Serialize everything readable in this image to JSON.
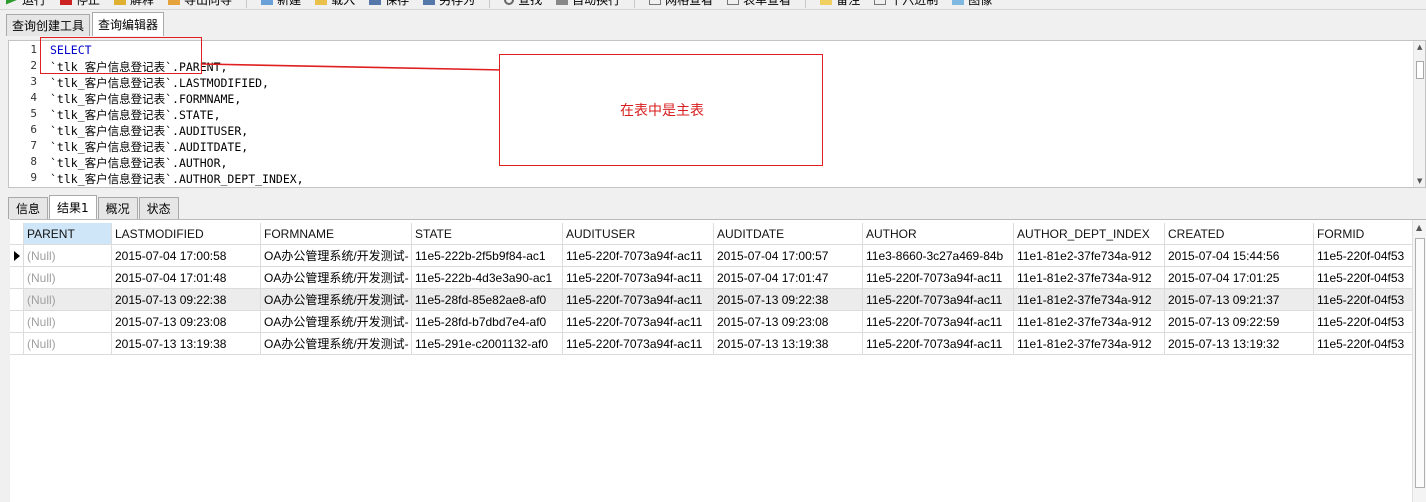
{
  "toolbar": {
    "items": [
      "运行",
      "停止",
      "解释",
      "导出向导",
      "新建",
      "载入",
      "保存",
      "另存为",
      "查找",
      "自动换行",
      "网格查看",
      "表单查看",
      "备注",
      "十六进制",
      "图像"
    ]
  },
  "editor_tabs": [
    "查询创建工具",
    "查询编辑器"
  ],
  "editor": {
    "lines": [
      {
        "n": "1",
        "text": "SELECT"
      },
      {
        "n": "2",
        "text": "`tlk_客户信息登记表`.PARENT,"
      },
      {
        "n": "3",
        "text": "`tlk_客户信息登记表`.LASTMODIFIED,"
      },
      {
        "n": "4",
        "text": "`tlk_客户信息登记表`.FORMNAME,"
      },
      {
        "n": "5",
        "text": "`tlk_客户信息登记表`.STATE,"
      },
      {
        "n": "6",
        "text": "`tlk_客户信息登记表`.AUDITUSER,"
      },
      {
        "n": "7",
        "text": "`tlk_客户信息登记表`.AUDITDATE,"
      },
      {
        "n": "8",
        "text": "`tlk_客户信息登记表`.AUTHOR,"
      },
      {
        "n": "9",
        "text": "`tlk_客户信息登记表`.AUTHOR_DEPT_INDEX,"
      }
    ]
  },
  "annotation": {
    "text": "在表中是主表",
    "color": "#d81e1e"
  },
  "result_tabs": [
    "信息",
    "结果1",
    "概况",
    "状态"
  ],
  "grid": {
    "columns": [
      "PARENT",
      "LASTMODIFIED",
      "FORMNAME",
      "STATE",
      "AUDITUSER",
      "AUDITDATE",
      "AUTHOR",
      "AUTHOR_DEPT_INDEX",
      "CREATED",
      "FORMID"
    ],
    "rows": [
      [
        "(Null)",
        "2015-07-04 17:00:58",
        "OA办公管理系统/开发测试-",
        "11e5-222b-2f5b9f84-ac1",
        "11e5-220f-7073a94f-ac11",
        "2015-07-04 17:00:57",
        "11e3-8660-3c27a469-84b",
        "11e1-81e2-37fe734a-912",
        "2015-07-04 15:44:56",
        "11e5-220f-04f53"
      ],
      [
        "(Null)",
        "2015-07-04 17:01:48",
        "OA办公管理系统/开发测试-",
        "11e5-222b-4d3e3a90-ac1",
        "11e5-220f-7073a94f-ac11",
        "2015-07-04 17:01:47",
        "11e5-220f-7073a94f-ac11",
        "11e1-81e2-37fe734a-912",
        "2015-07-04 17:01:25",
        "11e5-220f-04f53"
      ],
      [
        "(Null)",
        "2015-07-13 09:22:38",
        "OA办公管理系统/开发测试-",
        "11e5-28fd-85e82ae8-af0",
        "11e5-220f-7073a94f-ac11",
        "2015-07-13 09:22:38",
        "11e5-220f-7073a94f-ac11",
        "11e1-81e2-37fe734a-912",
        "2015-07-13 09:21:37",
        "11e5-220f-04f53"
      ],
      [
        "(Null)",
        "2015-07-13 09:23:08",
        "OA办公管理系统/开发测试-",
        "11e5-28fd-b7dbd7e4-af0",
        "11e5-220f-7073a94f-ac11",
        "2015-07-13 09:23:08",
        "11e5-220f-7073a94f-ac11",
        "11e1-81e2-37fe734a-912",
        "2015-07-13 09:22:59",
        "11e5-220f-04f53"
      ],
      [
        "(Null)",
        "2015-07-13 13:19:38",
        "OA办公管理系统/开发测试-",
        "11e5-291e-c2001132-af0",
        "11e5-220f-7073a94f-ac11",
        "2015-07-13 13:19:38",
        "11e5-220f-7073a94f-ac11",
        "11e1-81e2-37fe734a-912",
        "2015-07-13 13:19:32",
        "11e5-220f-04f53"
      ]
    ]
  }
}
